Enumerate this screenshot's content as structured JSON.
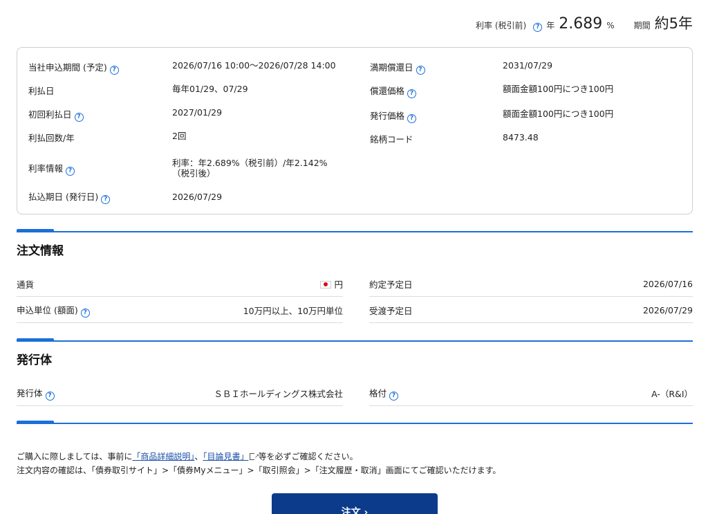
{
  "rate_header": {
    "rate_label": "利率 (税引前)",
    "year_prefix": "年",
    "rate_value": "2.689",
    "rate_unit": "%",
    "term_label": "期間",
    "term_value": "約5年"
  },
  "spec": {
    "left": [
      {
        "label": "当社申込期間 (予定)",
        "help": true,
        "value": "2026/07/16 10:00〜2026/07/28 14:00"
      },
      {
        "label": "利払日",
        "help": false,
        "value": "毎年01/29、07/29"
      },
      {
        "label": "初回利払日",
        "help": true,
        "value": "2027/01/29"
      },
      {
        "label": "利払回数/年",
        "help": false,
        "value": "2回"
      },
      {
        "label": "利率情報",
        "help": true,
        "value": "利率：年2.689%（税引前）/年2.142%",
        "value2": "（税引後）"
      },
      {
        "label": "払込期日 (発行日)",
        "help": true,
        "value": "2026/07/29"
      }
    ],
    "right": [
      {
        "label": "満期償還日",
        "help": true,
        "value": "2031/07/29"
      },
      {
        "label": "償還価格",
        "help": true,
        "value": "額面金額100円につき100円"
      },
      {
        "label": "発行価格",
        "help": true,
        "value": "額面金額100円につき100円"
      },
      {
        "label": "銘柄コード",
        "help": false,
        "value": "8473.48"
      }
    ]
  },
  "order_info": {
    "title": "注文情報",
    "currency_label": "通貨",
    "currency_value": "円",
    "unit_label": "申込単位 (額面)",
    "unit_value": "10万円以上、10万円単位",
    "contract_label": "約定予定日",
    "contract_value": "2026/07/16",
    "delivery_label": "受渡予定日",
    "delivery_value": "2026/07/29"
  },
  "issuer": {
    "title": "発行体",
    "issuer_label": "発行体",
    "issuer_value": "ＳＢＩホールディングス株式会社",
    "rating_label": "格付",
    "rating_value": "A-（R&I）"
  },
  "notes": {
    "line1_pre": "ご購入に際しましては、事前に",
    "link1": "「商品詳細説明」",
    "sep": "、",
    "link2": "「目論見書」",
    "line1_post": "等を必ずご確認ください。",
    "line2": "注文内容の確認は、「債券取引サイト」>「債券Myメニュー」>「取引照会」>「注文履歴・取消」画面にてご確認いただけます。"
  },
  "order_button": "注文 ›"
}
